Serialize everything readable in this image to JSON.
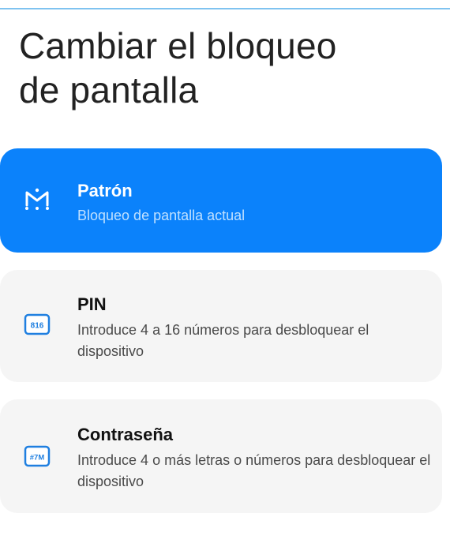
{
  "page": {
    "title": "Cambiar el bloqueo\nde pantalla"
  },
  "options": [
    {
      "title": "Patrón",
      "subtitle": "Bloqueo de pantalla actual",
      "icon": "pattern-icon",
      "selected": true
    },
    {
      "title": "PIN",
      "subtitle": "Introduce 4 a 16 números para desbloquear el dispositivo",
      "icon": "pin-icon",
      "icon_text": "816",
      "selected": false
    },
    {
      "title": "Contraseña",
      "subtitle": "Introduce 4 o más letras o números para desbloquear el dispositivo",
      "icon": "password-icon",
      "icon_text": "#7M",
      "selected": false
    }
  ],
  "colors": {
    "accent": "#0b82fb",
    "card_background": "#f5f5f5",
    "icon_outline": "#1f7fe0"
  }
}
